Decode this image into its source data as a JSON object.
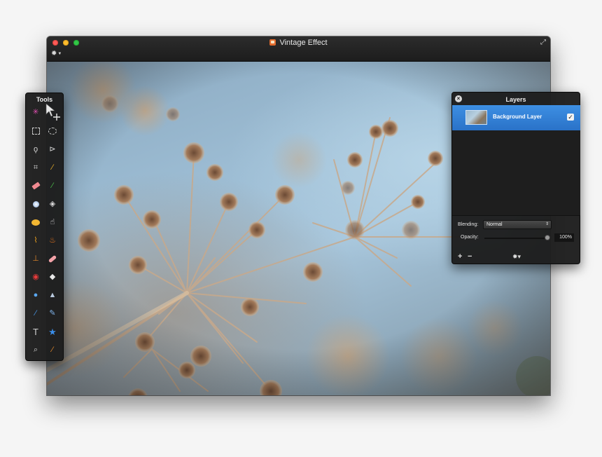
{
  "window": {
    "title": "Vintage Effect",
    "icons": {
      "document": "document-icon",
      "fullscreen": "fullscreen-icon",
      "settings": "gear-icon"
    }
  },
  "tools_panel": {
    "title": "Tools",
    "tools": [
      "magic-select-icon",
      "move-icon",
      "rect-select-icon",
      "ellipse-select-icon",
      "lasso-icon",
      "polygon-lasso-icon",
      "crop-icon",
      "eyedropper-icon",
      "eraser-icon",
      "pencil-icon",
      "blur-icon",
      "sharpen-icon",
      "sponge-icon",
      "smudge-icon",
      "brush-icon",
      "burn-icon",
      "stamp-icon",
      "bandage-icon",
      "red-eye-icon",
      "bucket-icon",
      "drop-icon",
      "gradient-icon",
      "pen-icon",
      "pen-vector-icon",
      "text-icon",
      "shape-star-icon",
      "zoom-icon",
      "color-picker-icon"
    ]
  },
  "layers_panel": {
    "title": "Layers",
    "layers": [
      {
        "name": "Background Layer",
        "visible": true,
        "selected": true
      }
    ],
    "blending_label": "Blending:",
    "blending_value": "Normal",
    "opacity_label": "Opacity:",
    "opacity_value": "100%",
    "opacity_fraction": 1.0,
    "footer": {
      "add_label": "+",
      "remove_label": "−",
      "settings_label": "✹▾"
    }
  },
  "colors": {
    "selection_blue": "#2f7ad0",
    "panel_bg": "#1c1c1c",
    "titlebar_bg": "#242424"
  }
}
